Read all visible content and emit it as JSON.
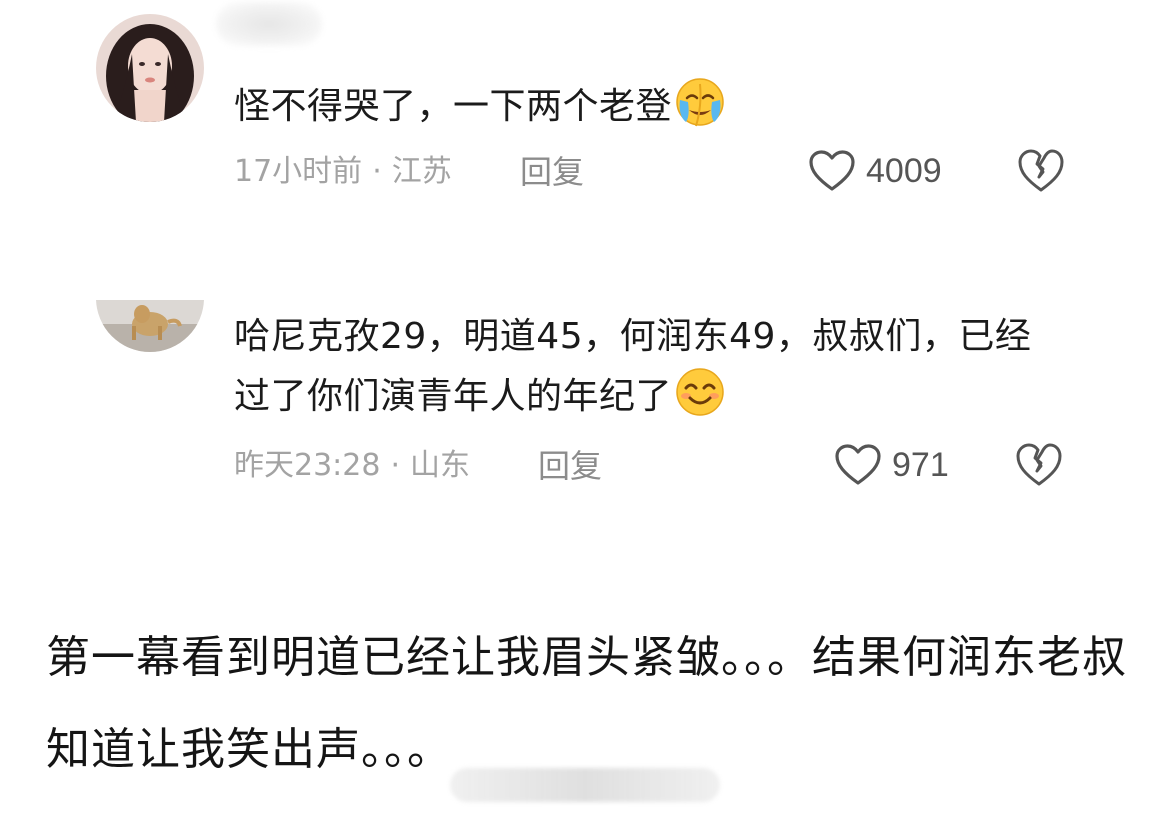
{
  "comments": [
    {
      "text": "怪不得哭了，一下两个老登",
      "emoji": "crying-face-emoji",
      "time": "17小时前",
      "location": "江苏",
      "reply_label": "回复",
      "likes": "4009"
    },
    {
      "text": "哈尼克孜29，明道45，何润东49，叔叔们，已经过了你们演青年人的年纪了",
      "emoji": "smiling-face-emoji",
      "time": "昨天23:28",
      "location": "山东",
      "reply_label": "回复",
      "likes": "971"
    }
  ],
  "post": {
    "text": "第一幕看到明道已经让我眉头紧皱。。。结果何润东老叔知道让我笑出声。。。"
  },
  "colors": {
    "meta_text": "#a3a3a3",
    "body_text": "#1b1b1b",
    "icon_stroke": "#555555"
  }
}
